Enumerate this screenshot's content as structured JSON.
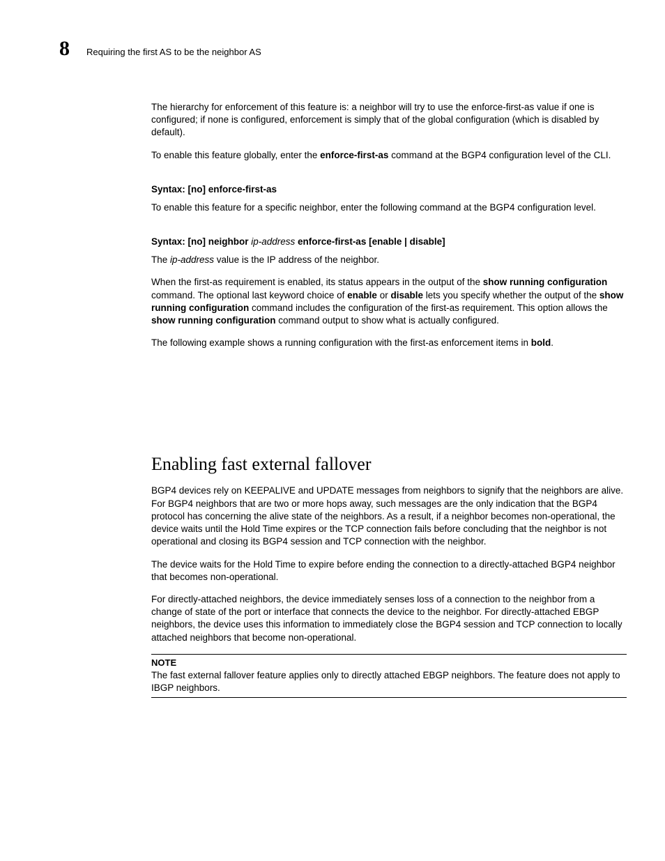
{
  "header": {
    "chapter_number": "8",
    "running_title": "Requiring the first AS to be the neighbor AS"
  },
  "body": {
    "p1_a": "The hierarchy for enforcement of this feature is: a neighbor will try to use the enforce-first-as value if one is configured; if none is configured, enforcement is simply that of the global configuration (which is disabled by default).",
    "p2_a": "To enable this feature globally, enter the ",
    "p2_cmd": "enforce-first-as",
    "p2_b": " command at the BGP4 configuration level of the CLI.",
    "syntax1_label": "Syntax:  ",
    "syntax1_no": "[no] enforce-first-as",
    "p3": "To enable this feature for a specific neighbor, enter the following command at the BGP4 configuration level.",
    "syntax2_label": "Syntax:  ",
    "syntax2_a": "[no] neighbor ",
    "syntax2_var": "ip-address",
    "syntax2_b": " enforce-first-as [enable | disable]",
    "p4_a": "The ",
    "p4_var": "ip-address",
    "p4_b": " value is the IP address of the neighbor.",
    "p5_a": "When the first-as requirement is enabled, its status appears in the output of the ",
    "p5_cmd1": "show running configuration",
    "p5_b": " command. The optional last keyword choice of ",
    "p5_cmd2": "enable",
    "p5_c": " or ",
    "p5_cmd3": "disable",
    "p5_d": " lets you specify whether the output of the ",
    "p5_cmd4": "show running configuration",
    "p5_e": " command includes the configuration of the first-as requirement. This option allows the ",
    "p5_cmd5": "show running configuration",
    "p5_f": " command output to show what is actually configured.",
    "p6_a": "The following example shows a running configuration with the first-as enforcement items in ",
    "p6_bold": "bold",
    "p6_b": ".",
    "section_heading": "Enabling fast external fallover",
    "p7": "BGP4 devices rely on KEEPALIVE and UPDATE messages from neighbors to signify that the neighbors are alive. For BGP4 neighbors that are two or more hops away, such messages are the only indication that the BGP4 protocol has concerning the alive state of the neighbors. As a result, if a neighbor becomes non-operational, the device waits until the Hold Time expires or the TCP connection fails before concluding that the neighbor is not operational and closing its BGP4 session and TCP connection with the neighbor.",
    "p8": "The device waits for the Hold Time to expire before ending the connection to a directly-attached BGP4 neighbor that becomes non-operational.",
    "p9": "For directly-attached neighbors, the device immediately senses loss of a connection to the neighbor from a change of state of the port or interface that connects the device to the neighbor. For directly-attached EBGP neighbors, the device uses this information to immediately close the BGP4 session and TCP connection to locally attached neighbors that become non-operational.",
    "note_label": "NOTE",
    "note_text": "The fast external fallover feature applies only to directly attached EBGP neighbors. The feature does not apply to IBGP neighbors."
  }
}
